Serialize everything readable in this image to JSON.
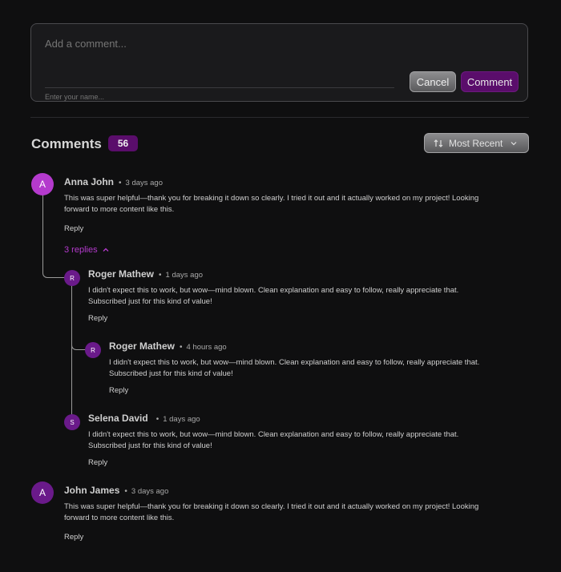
{
  "composer": {
    "comment_placeholder": "Add a comment...",
    "name_placeholder": "Enter your name...",
    "cancel_label": "Cancel",
    "comment_label": "Comment"
  },
  "header": {
    "title": "Comments",
    "count": "56",
    "sort_label": "Most Recent",
    "sort_icon": "sort-arrows-icon"
  },
  "replies_toggle_label": "3 replies",
  "reply_label": "Reply",
  "comments": [
    {
      "initial": "A",
      "name": "Anna John",
      "time": "3 days ago",
      "text_line1": "This was super helpful—thank you for breaking it down so clearly. I tried it out and it actually worked on my project! Looking",
      "text_line2": "forward to more content like this."
    },
    {
      "initial": "R",
      "name": "Roger Mathew",
      "time": "1 days ago",
      "text_line1": "I didn't expect this to work, but wow—mind blown. Clean explanation and easy to follow, really appreciate that.",
      "text_line2": "Subscribed just for this kind of value!"
    },
    {
      "initial": "R",
      "name": "Roger Mathew",
      "time": "4 hours ago",
      "text_line1": "I didn't expect this to work, but wow—mind blown. Clean explanation and easy to follow, really appreciate that.",
      "text_line2": "Subscribed just for this kind of value!"
    },
    {
      "initial": "S",
      "name": "Selena David",
      "time": "1 days ago",
      "text_line1": "I didn't expect this to work, but wow—mind blown. Clean explanation and easy to follow, really appreciate that.",
      "text_line2": "Subscribed just for this kind of value!"
    },
    {
      "initial": "A",
      "name": "John James",
      "time": "3 days ago",
      "text_line1": "This was super helpful—thank you for breaking it down so clearly. I tried it out and it actually worked on my project! Looking",
      "text_line2": "forward to more content like this."
    }
  ],
  "colors": {
    "accent": "#b43acd",
    "accent_dark": "#5a0d6b",
    "background": "#0f0f10"
  }
}
